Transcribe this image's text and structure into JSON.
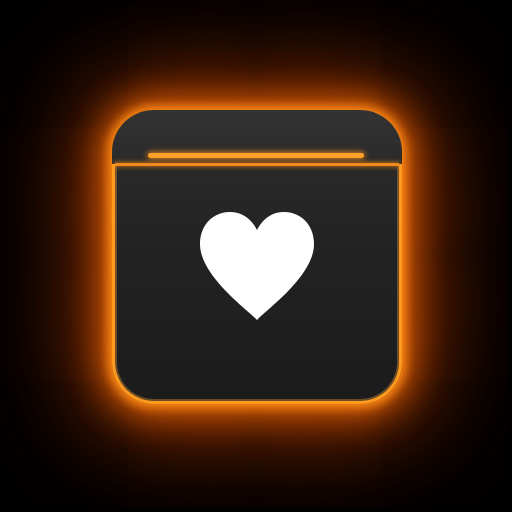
{
  "icon": {
    "symbol": "heart-icon",
    "colors": {
      "background": "#000000",
      "tile": "#242424",
      "glow": "#ff8c14",
      "accent_line": "#ffa12a",
      "heart": "#ffffff"
    }
  }
}
